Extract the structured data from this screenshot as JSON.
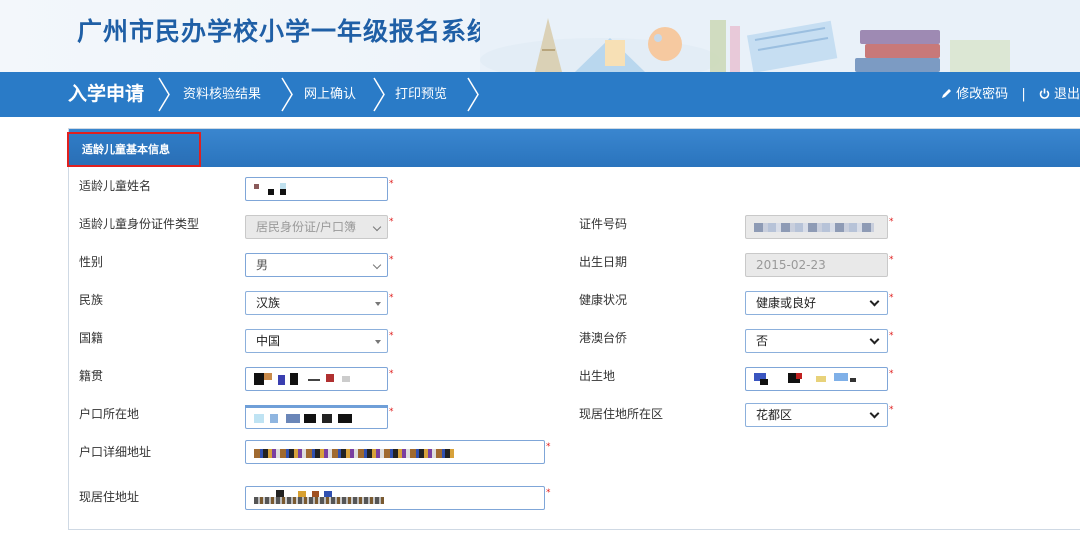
{
  "app": {
    "title": "广州市民办学校小学一年级报名系统"
  },
  "nav": {
    "main": "入学申请",
    "steps": [
      "资料核验结果",
      "网上确认",
      "打印预览"
    ],
    "change_password": "修改密码",
    "separator": "|",
    "logout": "退出"
  },
  "panel": {
    "tab": "适龄儿童基本信息"
  },
  "form": {
    "child_name": {
      "label": "适龄儿童姓名"
    },
    "id_type": {
      "label": "适龄儿童身份证件类型",
      "value": "居民身份证/户口簿"
    },
    "id_number": {
      "label": "证件号码"
    },
    "gender": {
      "label": "性别",
      "value": "男"
    },
    "birth_date": {
      "label": "出生日期",
      "value": "2015-02-23"
    },
    "ethnicity": {
      "label": "民族",
      "value": "汉族"
    },
    "health": {
      "label": "健康状况",
      "value": "健康或良好"
    },
    "nationality": {
      "label": "国籍",
      "value": "中国"
    },
    "hk_macau_tw": {
      "label": "港澳台侨",
      "value": "否"
    },
    "native_place": {
      "label": "籍贯"
    },
    "birthplace": {
      "label": "出生地"
    },
    "hukou_location": {
      "label": "户口所在地"
    },
    "residence_district": {
      "label": "现居住地所在区",
      "value": "花都区"
    },
    "hukou_address": {
      "label": "户口详细地址"
    },
    "residence_address": {
      "label": "现居住地址"
    }
  },
  "colors": {
    "nav": "#2a7bc7",
    "title": "#1f5fa6",
    "required": "#e0201f",
    "highlight": "#e0201f"
  }
}
